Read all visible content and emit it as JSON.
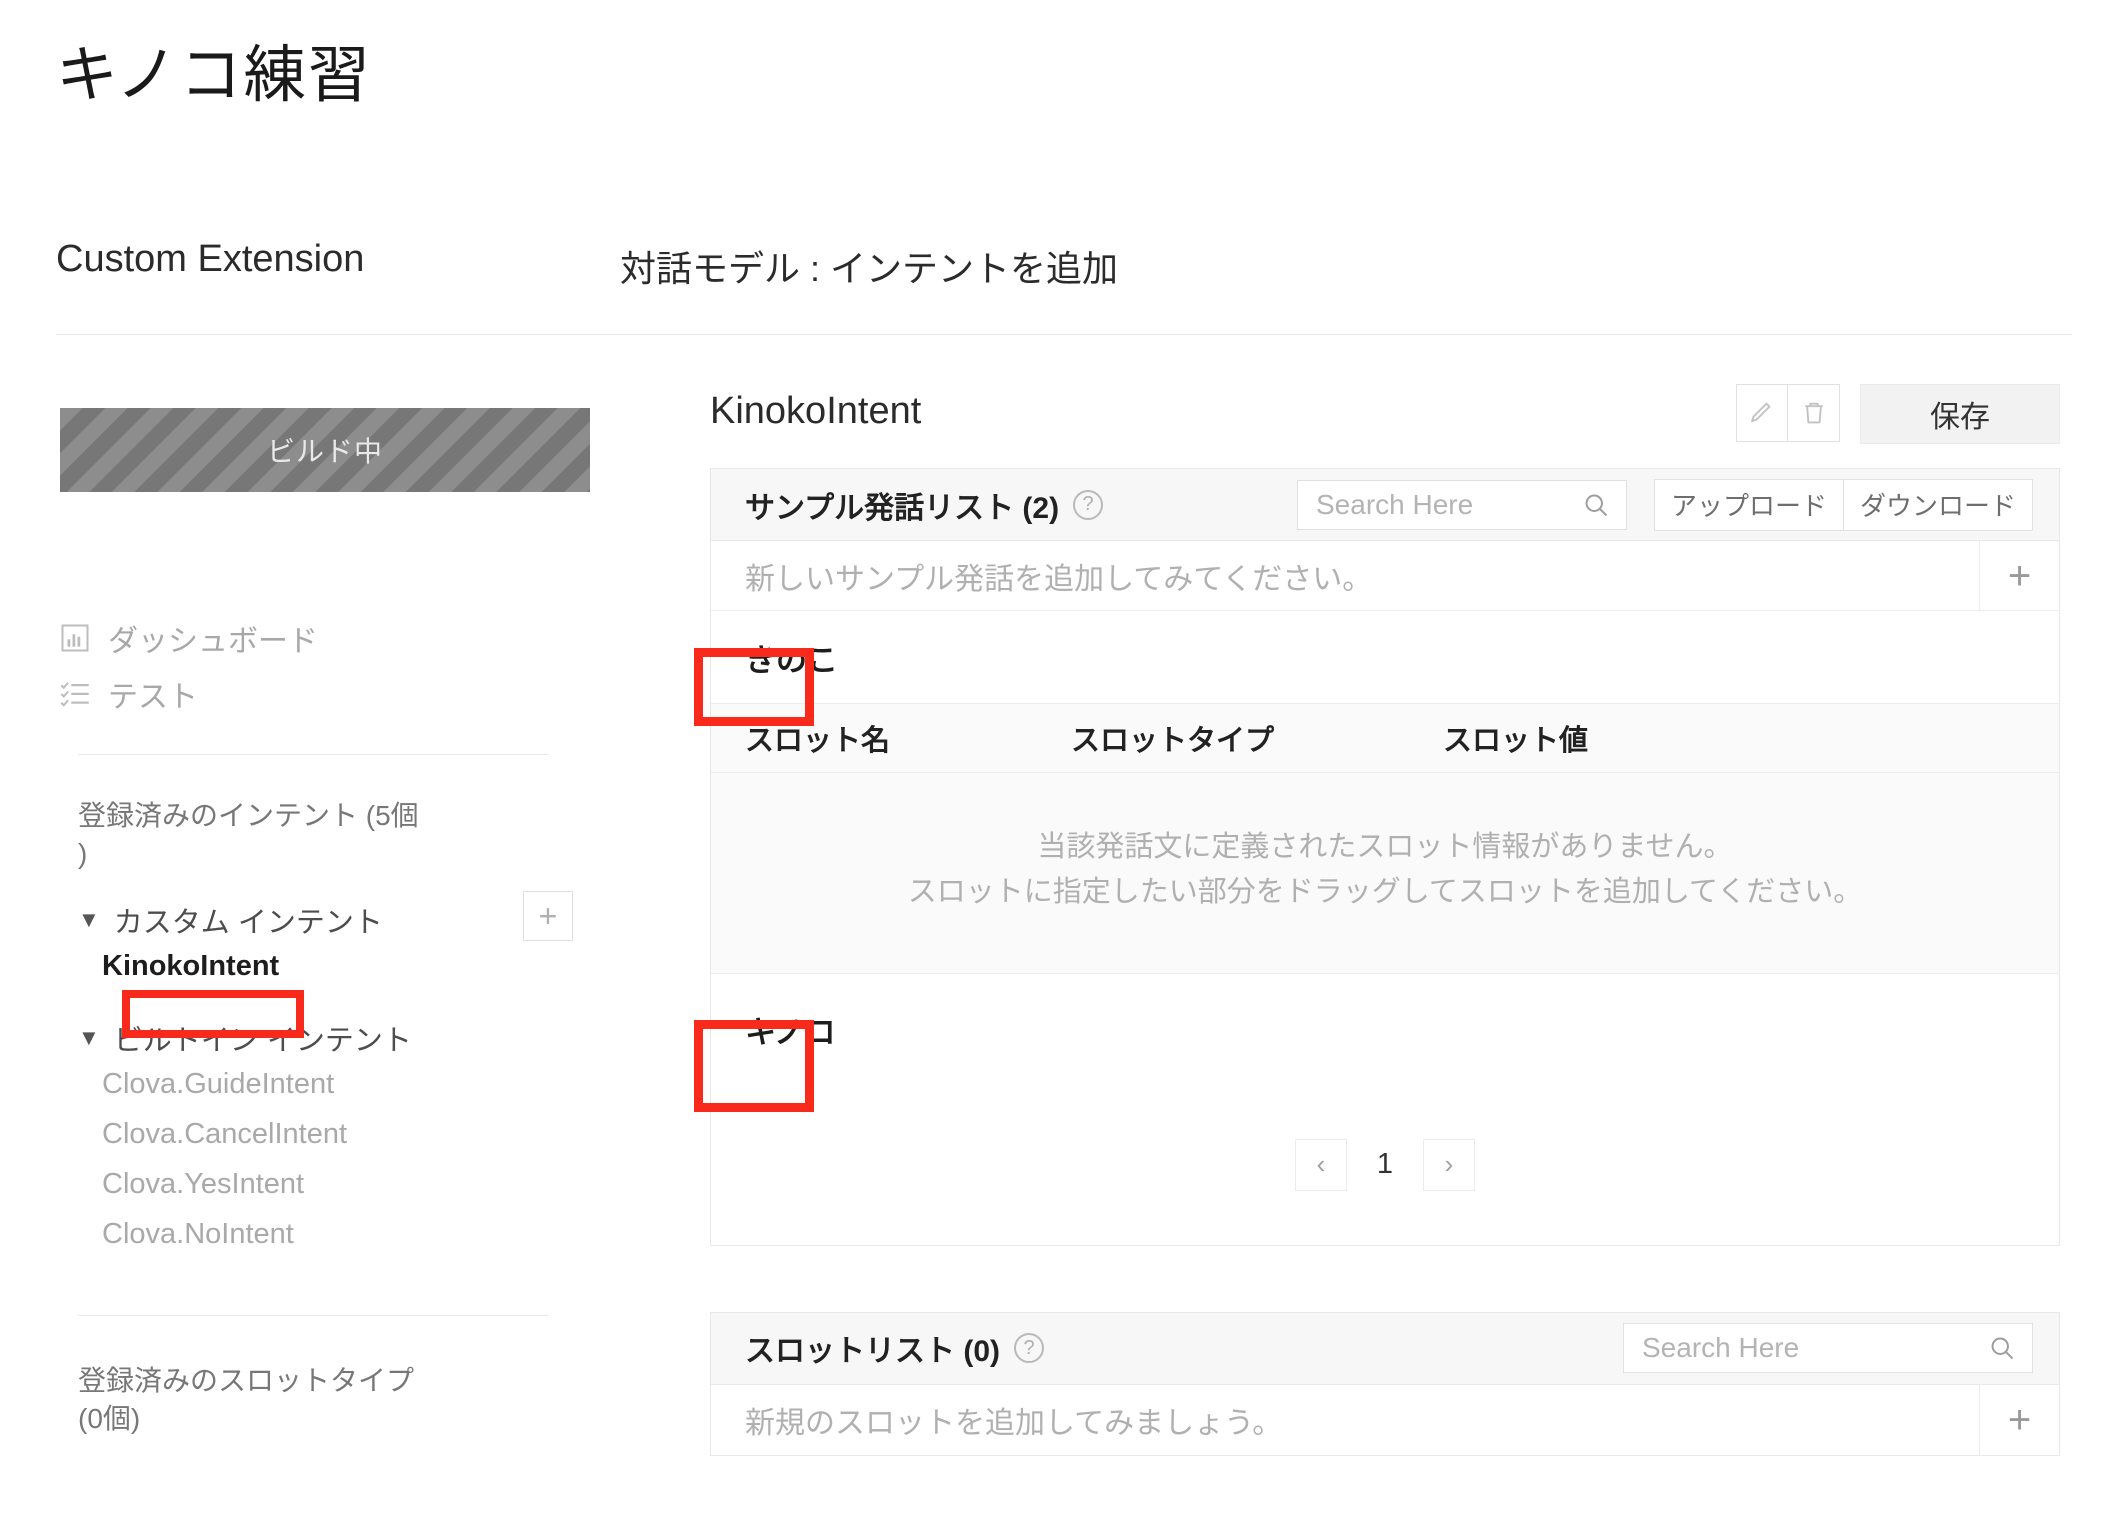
{
  "header": {
    "app_title": "キノコ練習",
    "breadcrumb_left": "Custom Extension",
    "breadcrumb_right": "対話モデル : インテントを追加"
  },
  "sidebar": {
    "build_status": "ビルド中",
    "nav": [
      {
        "label": "ダッシュボード",
        "icon": "dashboard-icon"
      },
      {
        "label": "テスト",
        "icon": "test-checklist-icon"
      }
    ],
    "intents_section_label": "登録済みのインテント (5個\n)",
    "custom_group": {
      "caret": "▼",
      "label": "カスタム インテント",
      "add_label": "+",
      "items": [
        {
          "label": "KinokoIntent",
          "selected": true
        }
      ]
    },
    "builtin_group": {
      "caret": "▼",
      "label": "ビルトイン インテント",
      "items": [
        {
          "label": "Clova.GuideIntent"
        },
        {
          "label": "Clova.CancelIntent"
        },
        {
          "label": "Clova.YesIntent"
        },
        {
          "label": "Clova.NoIntent"
        }
      ]
    },
    "slottypes_section_label": "登録済みのスロットタイプ\n(0個)"
  },
  "main": {
    "intent_name": "KinokoIntent",
    "edit_icon": "pencil-icon",
    "delete_icon": "trash-icon",
    "save_label": "保存",
    "utterance_card": {
      "title": "サンプル発話リスト (2)",
      "help_icon": "question-mark-icon",
      "search_placeholder": "Search Here",
      "search_value": "",
      "upload_label": "アップロード",
      "download_label": "ダウンロード",
      "add_row_text": "新しいサンプル発話を追加してみてください。",
      "add_plus": "+",
      "utterance_1": "きのこ",
      "utterance_2": "キノコ",
      "slot_columns": [
        "スロット名",
        "スロットタイプ",
        "スロット値"
      ],
      "slot_empty_line1": "当該発話文に定義されたスロット情報がありません。",
      "slot_empty_line2": "スロットに指定したい部分をドラッグしてスロットを追加してください。",
      "pager": {
        "prev": "‹",
        "page": "1",
        "next": "›"
      }
    },
    "slot_card": {
      "title": "スロットリスト (0)",
      "help_icon": "question-mark-icon",
      "search_placeholder": "Search Here",
      "search_value": "",
      "add_row_text": "新規のスロットを追加してみましょう。",
      "add_plus": "+"
    }
  },
  "annotations": {
    "highlight_color": "#f9291c",
    "boxes": [
      "KinokoIntent",
      "きのこ",
      "キノコ"
    ]
  }
}
